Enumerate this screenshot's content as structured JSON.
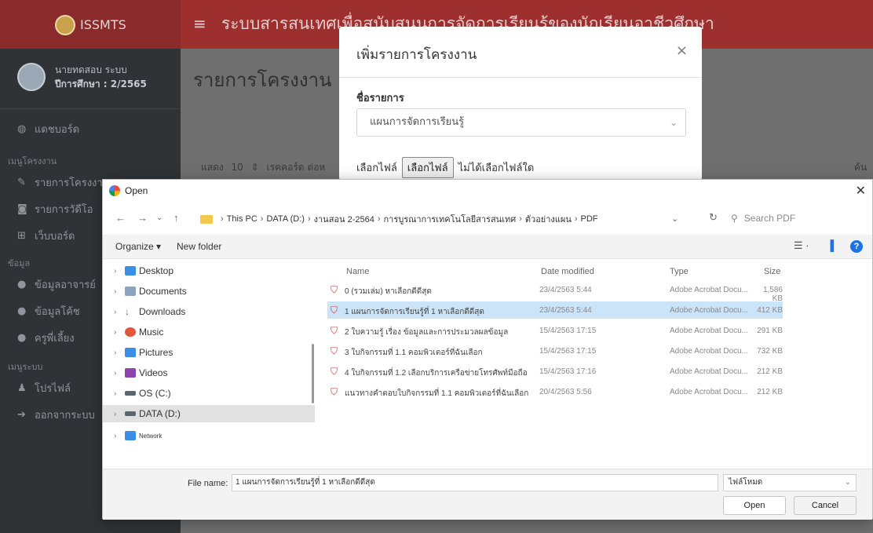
{
  "app": {
    "brand": "ISSMTS",
    "title": "ระบบสารสนเทศเพื่อสนับสนุนการจัดการเรียนรู้ของนักเรียนอาชีวศึกษา",
    "user_name": "นายทดสอบ ระบบ",
    "term": "ปีการศึกษา : 2/2565"
  },
  "sidebar": {
    "dashboard": "แดชบอร์ด",
    "menu_head": "เมนูโครงงาน",
    "items1": [
      "รายการโครงงาน",
      "รายการวัดีโอ",
      "เว็บบอร์ด"
    ],
    "data_head": "ข้อมูล",
    "items2": [
      "ข้อมูลอาจารย์",
      "ข้อมูลโค้ช",
      "ครูพี่เลี้ยง"
    ],
    "system_head": "เมนูระบบ",
    "items3": [
      "โปรไฟล์",
      "ออกจากระบบ"
    ]
  },
  "content": {
    "page_title": "รายการโครงงาน",
    "show": "แสดง",
    "show_val": "10",
    "records": "เรคคอร์ด ต่อห",
    "search": "ค้น"
  },
  "modal": {
    "title": "เพิ่มรายการโครงงาน",
    "label": "ชื่อรายการ",
    "select_value": "แผนการจัดการเรียนรู้",
    "file_label": "เลือกไฟล์",
    "file_button": "เลือกไฟล์",
    "no_file": "ไม่ได้เลือกไฟล์ใด"
  },
  "dialog": {
    "title": "Open",
    "breadcrumb": [
      "This PC",
      "DATA (D:)",
      "งานสอน 2-2564",
      "การบูรณาการเทคโนโลยีสารสนเทศ",
      "ตัวอย่างแผน",
      "PDF"
    ],
    "search_placeholder": "Search PDF",
    "organize": "Organize",
    "new_folder": "New folder",
    "nav_items": [
      "Desktop",
      "Documents",
      "Downloads",
      "Music",
      "Pictures",
      "Videos",
      "OS (C:)",
      "DATA (D:)",
      "Network"
    ],
    "columns": {
      "name": "Name",
      "date": "Date modified",
      "type": "Type",
      "size": "Size"
    },
    "files": [
      {
        "name": "0 (รวมเล่ม) หาเลือกดีดีสุด",
        "date": "23/4/2563 5:44",
        "type": "Adobe Acrobat Docu...",
        "size": "1,586 KB"
      },
      {
        "name": "1 แผนการจัดการเรียนรู้ที่ 1 หาเลือกดีดีสุด",
        "date": "23/4/2563 5:44",
        "type": "Adobe Acrobat Docu...",
        "size": "412 KB"
      },
      {
        "name": "2 ใบความรู้ เรื่อง ข้อมูลและการประมวลผลข้อมูล",
        "date": "15/4/2563 17:15",
        "type": "Adobe Acrobat Docu...",
        "size": "291 KB"
      },
      {
        "name": "3 ใบกิจกรรมที่ 1.1 คอมพิวเตอร์ที่ฉันเลือก",
        "date": "15/4/2563 17:15",
        "type": "Adobe Acrobat Docu...",
        "size": "732 KB"
      },
      {
        "name": "4 ใบกิจกรรมที่ 1.2 เลือกบริการเครือข่ายโทรศัพท์มือถือ",
        "date": "15/4/2563 17:16",
        "type": "Adobe Acrobat Docu...",
        "size": "212 KB"
      },
      {
        "name": "แนวทางคำตอบใบกิจกรรมที่ 1.1 คอมพิวเตอร์ที่ฉันเลือก",
        "date": "20/4/2563 5:56",
        "type": "Adobe Acrobat Docu...",
        "size": "212 KB"
      }
    ],
    "file_name_label": "File name:",
    "file_name_value": "1 แผนการจัดการเรียนรู้ที่ 1 หาเลือกดีดีสุด",
    "file_type": "ไฟล์โหมด",
    "open": "Open",
    "cancel": "Cancel"
  }
}
